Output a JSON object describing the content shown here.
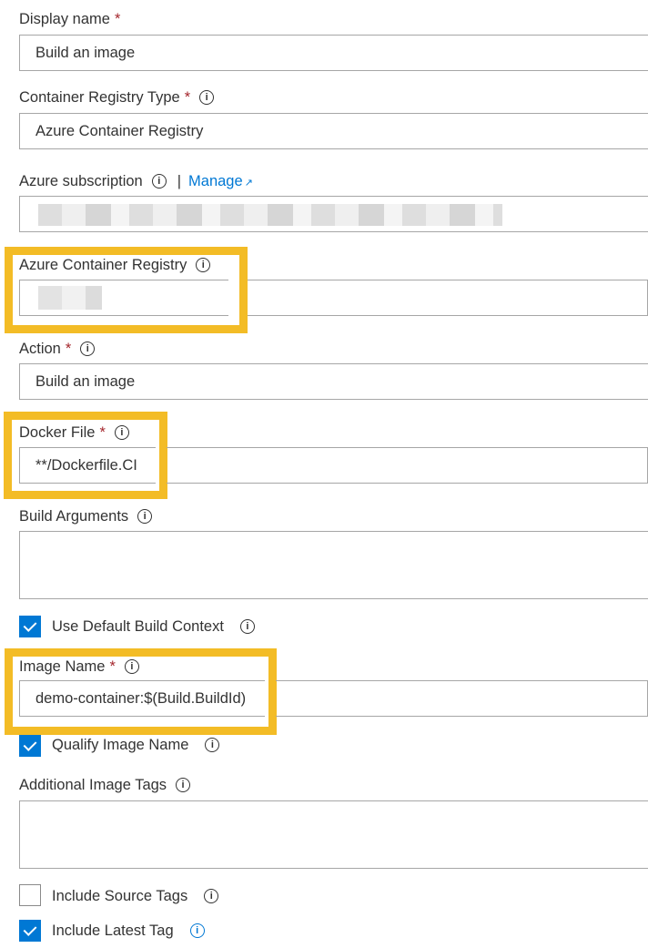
{
  "fields": {
    "display_name": {
      "label": "Display name",
      "value": "Build an image"
    },
    "registry_type": {
      "label": "Container Registry Type",
      "value": "Azure Container Registry"
    },
    "subscription": {
      "label": "Azure subscription",
      "separator": "|",
      "manage": "Manage"
    },
    "acr": {
      "label": "Azure Container Registry"
    },
    "action": {
      "label": "Action",
      "value": "Build an image"
    },
    "docker_file": {
      "label": "Docker File",
      "value": "**/Dockerfile.CI"
    },
    "build_args": {
      "label": "Build Arguments",
      "value": ""
    },
    "image_name": {
      "label": "Image Name",
      "value": "demo-container:$(Build.BuildId)"
    },
    "additional_tags": {
      "label": "Additional Image Tags",
      "value": ""
    }
  },
  "checkboxes": [
    {
      "label": "Use Default Build Context",
      "checked": true
    },
    {
      "label": "Qualify Image Name",
      "checked": true
    },
    {
      "label": "Include Source Tags",
      "checked": false
    },
    {
      "label": "Include Latest Tag",
      "checked": true
    }
  ],
  "required_mark": "*",
  "info_glyph": "i",
  "colors": {
    "highlight": "#f3bc26",
    "accent": "#0078d4",
    "required": "#a4262c"
  }
}
